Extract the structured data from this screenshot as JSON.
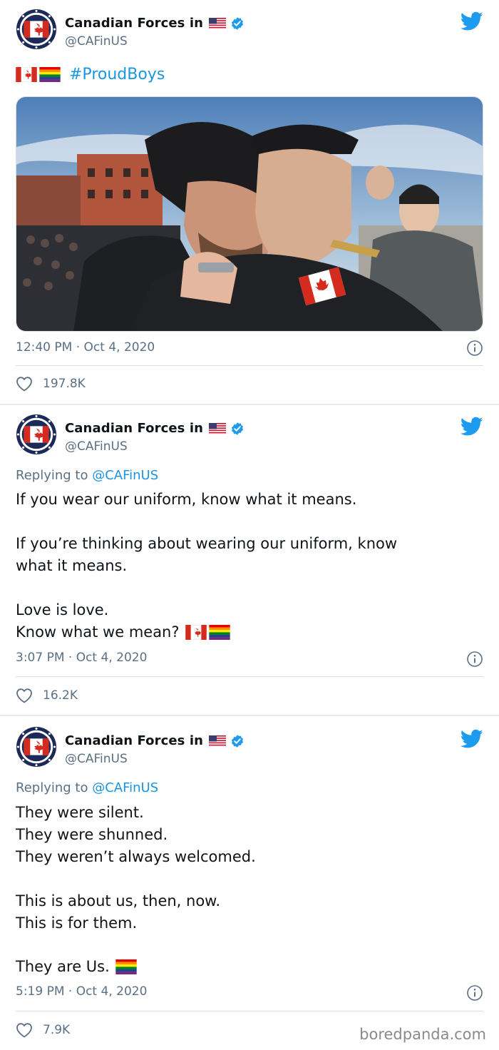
{
  "account": {
    "name": "Canadian Forces in",
    "handle": "@CAFinUS",
    "flag_icon": "us-flag-icon",
    "verified_icon": "verified-badge-icon",
    "brand_color": "#1b95e0"
  },
  "tweets": [
    {
      "hashtag": "#ProudBoys",
      "emojis": [
        "canada-flag",
        "rainbow-flag"
      ],
      "timestamp": "12:40 PM · Oct 4, 2020",
      "likes": "197.8K"
    },
    {
      "reply_prefix": "Replying to ",
      "reply_handle": "@CAFinUS",
      "lines": [
        "If you wear our uniform, know what it means.",
        "If you’re thinking about wearing our uniform, know",
        "what it means.",
        "Love is love.",
        "Know what we mean?"
      ],
      "timestamp": "3:07 PM · Oct 4, 2020",
      "likes": "16.2K"
    },
    {
      "reply_prefix": "Replying to ",
      "reply_handle": "@CAFinUS",
      "lines": [
        "They were silent.",
        "They were shunned.",
        "They weren’t always welcomed.",
        "This is about us, then, now.",
        "This is for them.",
        "They are Us."
      ],
      "timestamp": "5:19 PM · Oct 4, 2020",
      "likes": "7.9K"
    }
  ],
  "watermark": "boredpanda.com"
}
